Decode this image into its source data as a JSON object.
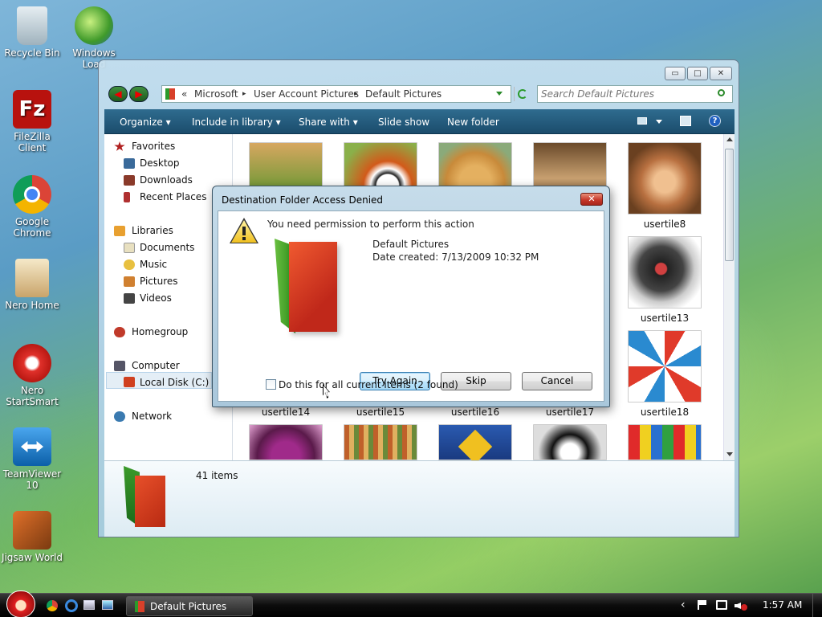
{
  "desktop": {
    "icons": [
      {
        "label": "Recycle Bin",
        "icon": "recycle-bin-icon"
      },
      {
        "label": "Windows Load",
        "icon": "windows-icon"
      },
      {
        "label": "FileZilla Client",
        "icon": "filezilla-icon"
      },
      {
        "label": "Google Chrome",
        "icon": "chrome-icon"
      },
      {
        "label": "Nero Home",
        "icon": "nero-home-icon"
      },
      {
        "label": "Nero StartSmart",
        "icon": "nero-icon"
      },
      {
        "label": "TeamViewer 10",
        "icon": "teamviewer-icon"
      },
      {
        "label": "Jigsaw World",
        "icon": "jigsaw-icon"
      }
    ]
  },
  "explorer": {
    "controls": {
      "minimize": "▭",
      "maximize": "□",
      "close": "✕"
    },
    "nav": {
      "back": "◀",
      "forward": "▶"
    },
    "address": {
      "chevron": "«",
      "crumbs": [
        "Microsoft",
        "User Account Pictures",
        "Default Pictures"
      ],
      "separator": "▸"
    },
    "search": {
      "placeholder": "Search Default Pictures"
    },
    "commands": [
      "Organize ▾",
      "Include in library ▾",
      "Share with ▾",
      "Slide show",
      "New folder"
    ],
    "sidebar": {
      "favorites": "Favorites",
      "favorite_items": [
        "Desktop",
        "Downloads",
        "Recent Places"
      ],
      "libraries": "Libraries",
      "library_items": [
        "Documents",
        "Music",
        "Pictures",
        "Videos"
      ],
      "homegroup": "Homegroup",
      "computer": "Computer",
      "local_disk": "Local Disk (C:)",
      "network": "Network"
    },
    "thumbnails_labels": {
      "col5_row1": "usertile8",
      "col5_row2": "usertile13",
      "row3": [
        "usertile14",
        "usertile15",
        "usertile16",
        "usertile17",
        "usertile18"
      ]
    },
    "details": {
      "count": "41 items"
    }
  },
  "dialog": {
    "title": "Destination Folder Access Denied",
    "close": "✕",
    "message": "You need permission to perform this action",
    "item_name": "Default Pictures",
    "item_date": "Date created: 7/13/2009 10:32 PM",
    "buttons": {
      "try_again": "Try Again",
      "skip": "Skip",
      "cancel": "Cancel"
    },
    "checkbox_label": "Do this for all current items (2 found)"
  },
  "taskbar": {
    "task_label": "Default Pictures",
    "clock": "1:57 AM",
    "tray_chevron": "‹"
  },
  "colors": {
    "dialog_title_bg": "#b9d3e4",
    "close_red": "#c7392b",
    "taskbar": "#1a1a1a",
    "command_bar": "#245b7d"
  }
}
